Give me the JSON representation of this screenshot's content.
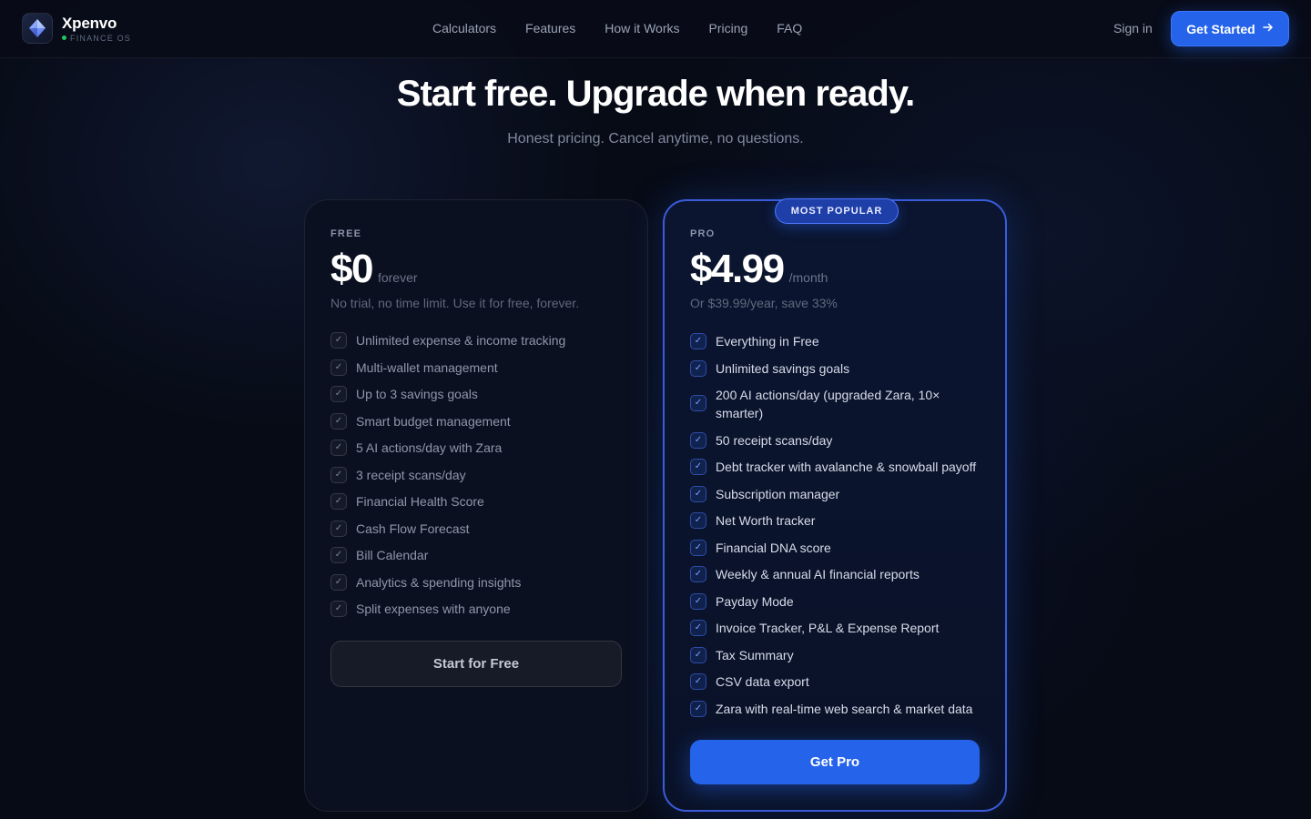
{
  "header": {
    "brand": "Xpenvo",
    "subbrand": "FINANCE OS",
    "nav": [
      "Calculators",
      "Features",
      "How it Works",
      "Pricing",
      "FAQ"
    ],
    "signin": "Sign in",
    "cta": "Get Started"
  },
  "hero": {
    "title": "Start free. Upgrade when ready.",
    "subtitle": "Honest pricing. Cancel anytime, no questions."
  },
  "plans": {
    "free": {
      "label": "FREE",
      "price": "$0",
      "period": "forever",
      "description": "No trial, no time limit. Use it for free, forever.",
      "features": [
        "Unlimited expense & income tracking",
        "Multi-wallet management",
        "Up to 3 savings goals",
        "Smart budget management",
        "5 AI actions/day with Zara",
        "3 receipt scans/day",
        "Financial Health Score",
        "Cash Flow Forecast",
        "Bill Calendar",
        "Analytics & spending insights",
        "Split expenses with anyone"
      ],
      "button": "Start for Free"
    },
    "pro": {
      "badge": "MOST POPULAR",
      "label": "PRO",
      "price": "$4.99",
      "period": "/month",
      "description": "Or $39.99/year, save 33%",
      "features": [
        "Everything in Free",
        "Unlimited savings goals",
        "200 AI actions/day (upgraded Zara, 10× smarter)",
        "50 receipt scans/day",
        "Debt tracker with avalanche & snowball payoff",
        "Subscription manager",
        "Net Worth tracker",
        "Financial DNA score",
        "Weekly & annual AI financial reports",
        "Payday Mode",
        "Invoice Tracker, P&L & Expense Report",
        "Tax Summary",
        "CSV data export",
        "Zara with real-time web search & market data"
      ],
      "button": "Get Pro"
    }
  },
  "colors": {
    "accent": "#2563eb",
    "background": "#070b16",
    "status_dot": "#22c55e"
  }
}
